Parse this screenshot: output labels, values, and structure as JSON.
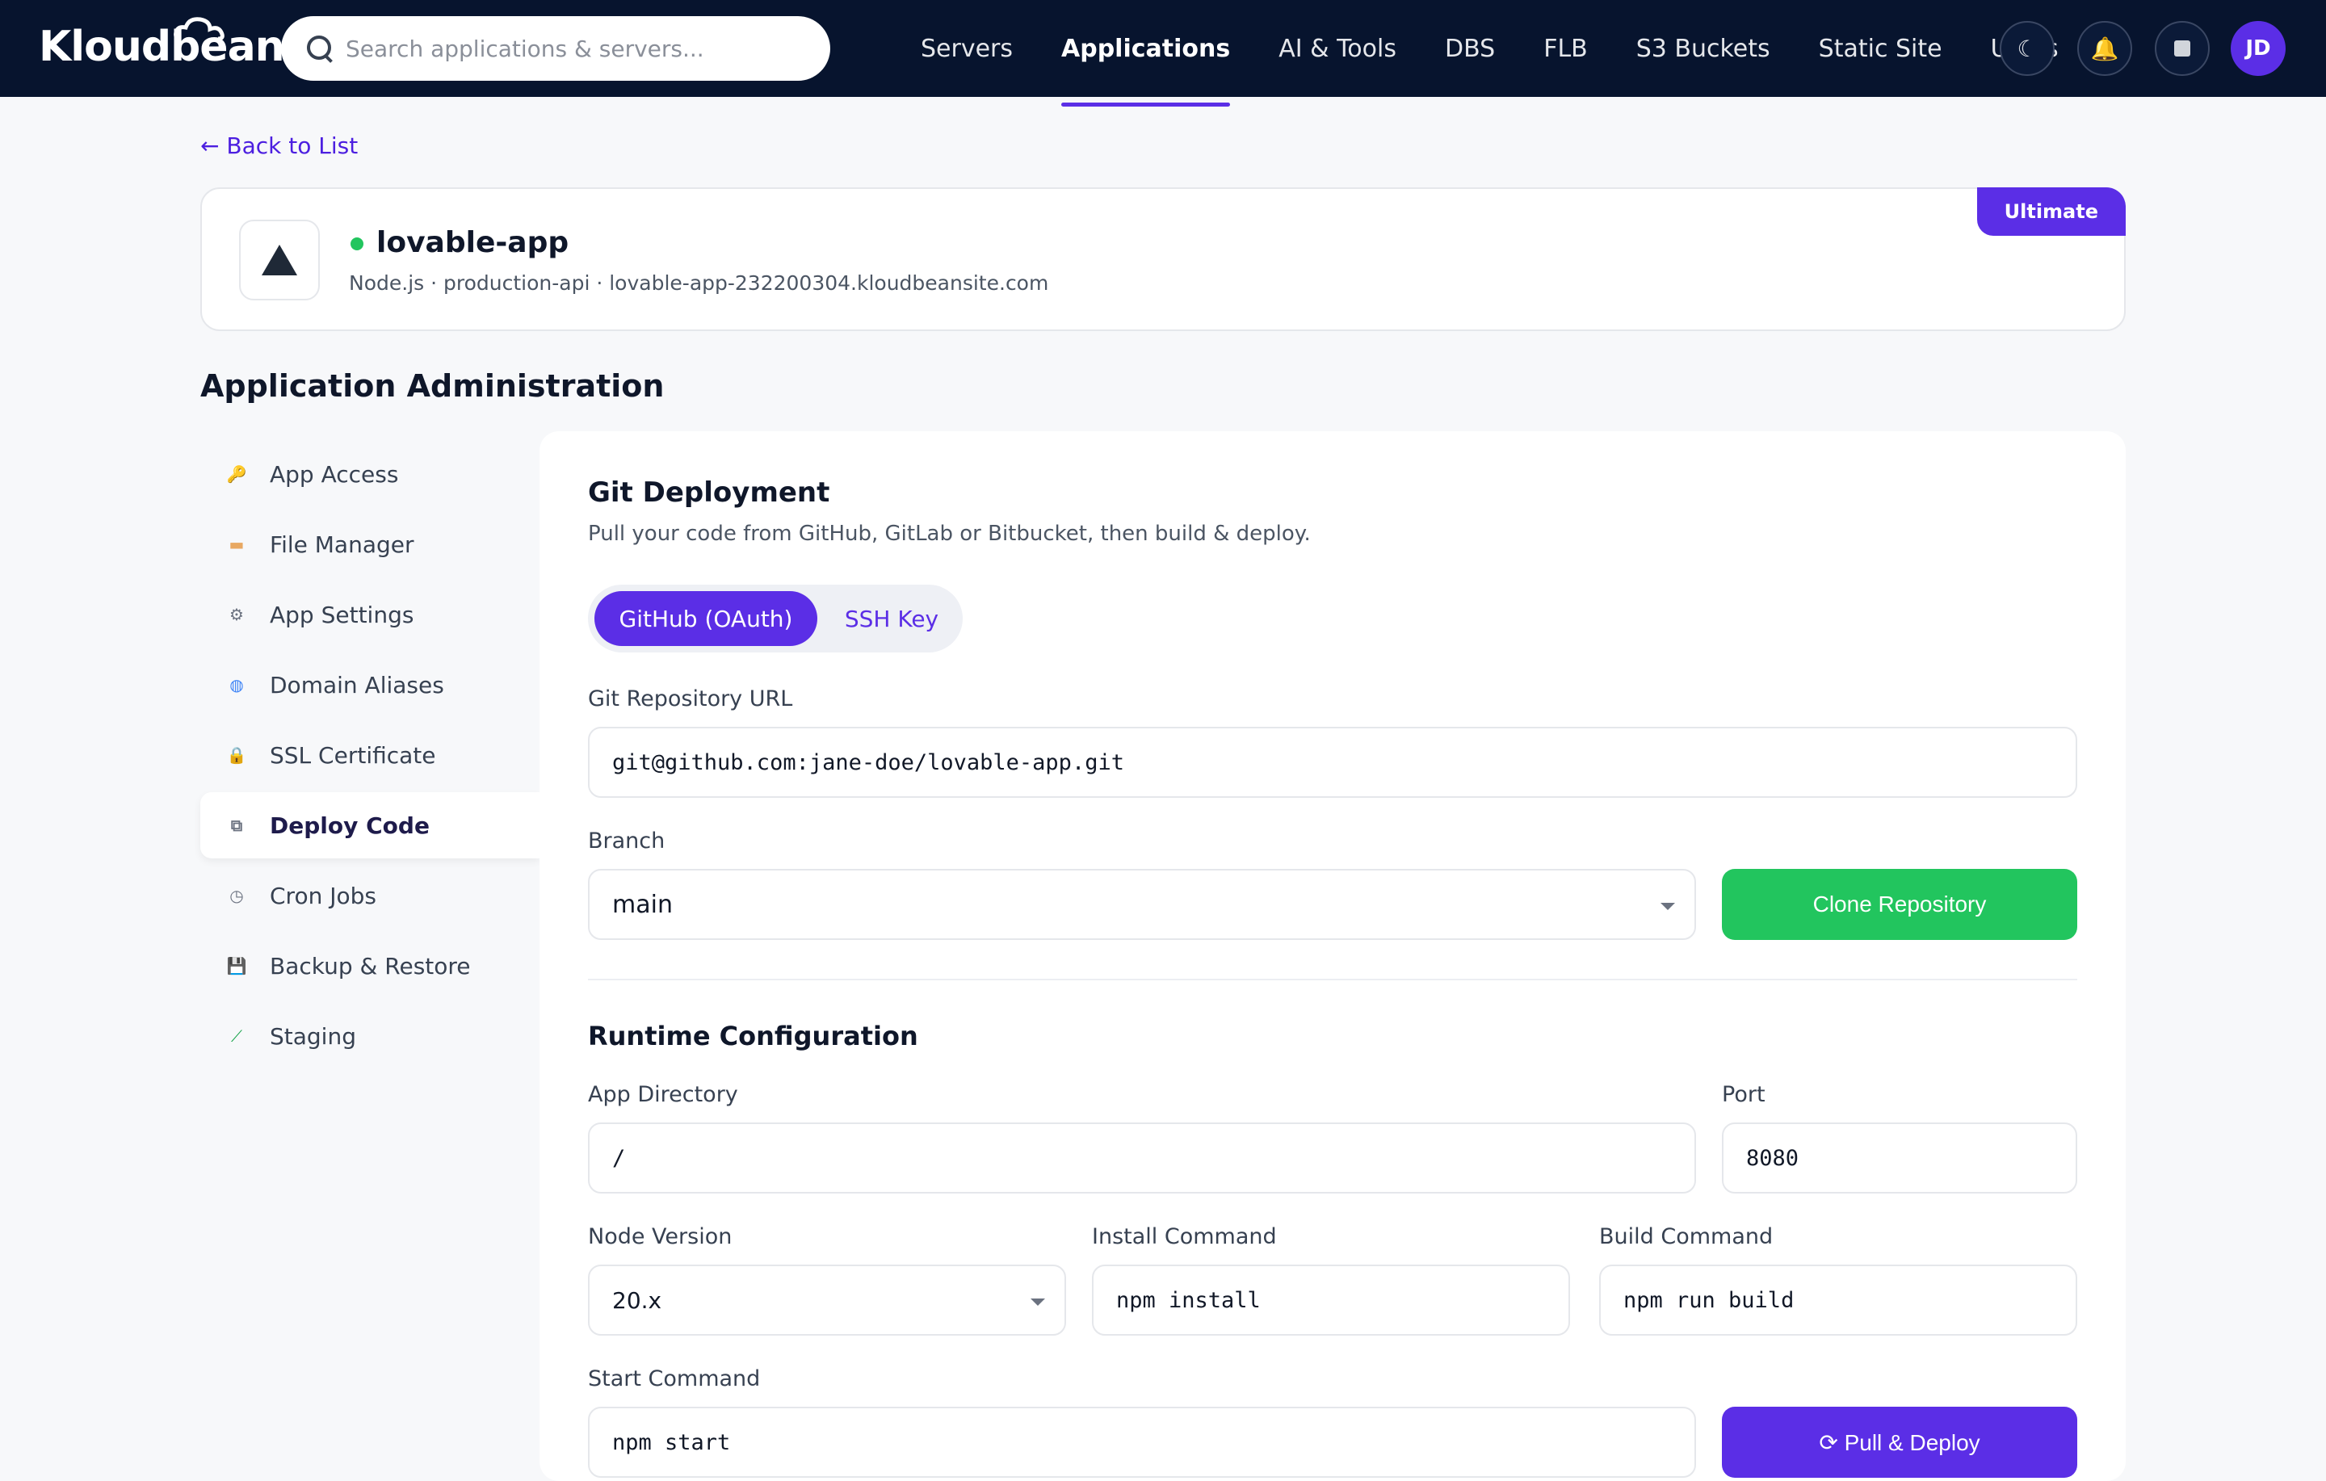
{
  "topbar": {
    "logo": "Kloudbean",
    "search_placeholder": "Search applications & servers...",
    "nav": [
      "Servers",
      "Applications",
      "AI & Tools",
      "DBS",
      "FLB",
      "S3 Buckets",
      "Static Site",
      "Users"
    ],
    "active_nav": "Applications",
    "avatar_initials": "JD"
  },
  "back_link": "← Back to List",
  "app": {
    "name": "lovable-app",
    "status": "online",
    "meta": "Node.js · production-api · lovable-app-232200304.kloudbeansite.com",
    "plan_badge": "Ultimate"
  },
  "section_title": "Application Administration",
  "sidebar": {
    "items": [
      {
        "label": "App Access",
        "icon": "key-icon"
      },
      {
        "label": "File Manager",
        "icon": "folder-icon"
      },
      {
        "label": "App Settings",
        "icon": "gear-icon"
      },
      {
        "label": "Domain Aliases",
        "icon": "globe-icon"
      },
      {
        "label": "SSL Certificate",
        "icon": "lock-icon"
      },
      {
        "label": "Deploy Code",
        "icon": "deploy-icon"
      },
      {
        "label": "Cron Jobs",
        "icon": "clock-icon"
      },
      {
        "label": "Backup & Restore",
        "icon": "floppy-icon"
      },
      {
        "label": "Staging",
        "icon": "test-tube-icon"
      }
    ],
    "active": "Deploy Code"
  },
  "git": {
    "title": "Git Deployment",
    "subtitle": "Pull your code from GitHub, GitLab or Bitbucket, then build & deploy.",
    "tab_github": "GitHub (OAuth)",
    "tab_ssh": "SSH Key",
    "repo_label": "Git Repository URL",
    "repo_value": "git@github.com:jane-doe/lovable-app.git",
    "branch_label": "Branch",
    "branch_value": "main",
    "clone_button": "Clone Repository"
  },
  "runtime": {
    "title": "Runtime Configuration",
    "app_dir_label": "App Directory",
    "app_dir_value": "/",
    "port_label": "Port",
    "port_value": "8080",
    "node_label": "Node Version",
    "node_value": "20.x",
    "install_label": "Install Command",
    "install_value": "npm install",
    "build_label": "Build Command",
    "build_value": "npm run build",
    "start_label": "Start Command",
    "start_value": "npm start",
    "deploy_button": "⟳ Pull & Deploy"
  },
  "colors": {
    "nav_bg": "#07142e",
    "accent": "#5b2ee6",
    "success": "#22c55e"
  }
}
